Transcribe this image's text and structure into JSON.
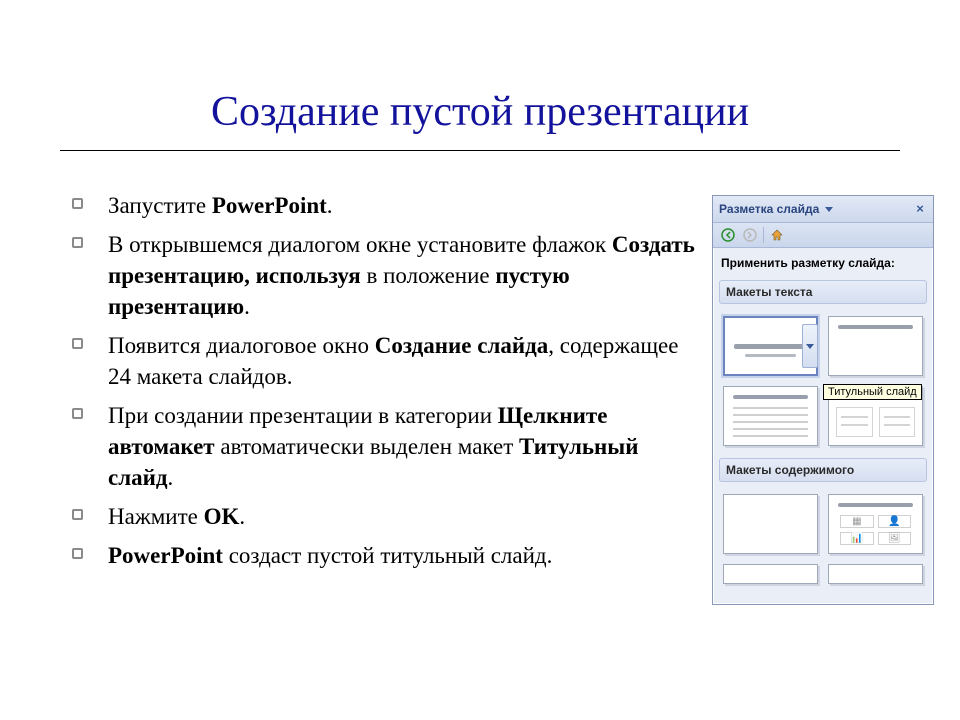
{
  "title": "Создание пустой презентации",
  "bullets": {
    "b1": {
      "t1": "Запустите ",
      "bold1": "PowerPoint",
      "t2": "."
    },
    "b2": {
      "t1": "В открывшемся диалогом окне установите флажок ",
      "bold1": "Создать презентацию, используя",
      "t2": " в положение ",
      "bold2": "пустую презентацию",
      "t3": "."
    },
    "b3": {
      "t1": "Появится диалоговое окно ",
      "bold1": "Создание слайда",
      "t2": ", содержащее 24 макета слайдов."
    },
    "b4": {
      "t1": "При создании презентации в категории ",
      "bold1": "Щелкните автомакет",
      "t2": " автоматически выделен макет ",
      "bold2": "Титульный слайд",
      "t3": "."
    },
    "b5": {
      "t1": "Нажмите ",
      "bold1": "OK",
      "t2": "."
    },
    "b6": {
      "bold1": "PowerPoint",
      "t1": " создаст пустой титульный слайд."
    }
  },
  "taskpane": {
    "title": "Разметка слайда",
    "close_glyph": "×",
    "back_glyph": "⟲",
    "fwd_glyph": "⟳",
    "apply_label": "Применить разметку слайда:",
    "section_text": "Макеты текста",
    "section_content": "Макеты содержимого",
    "tooltip": "Титульный слайд"
  }
}
